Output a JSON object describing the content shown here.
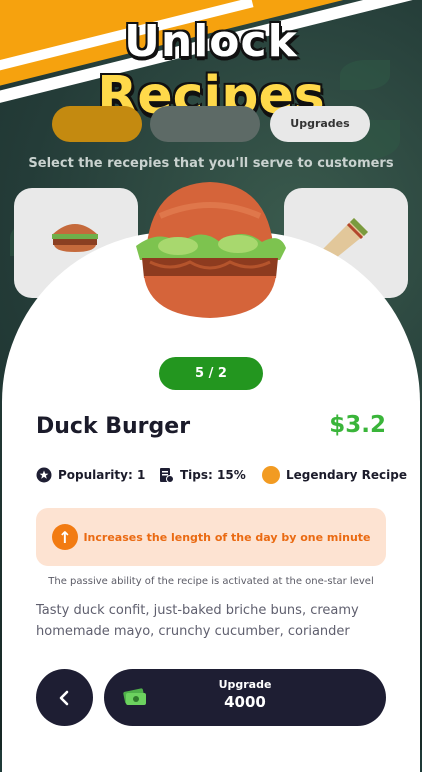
{
  "header": {
    "title_line1": "Unlock",
    "title_line2": "Recipes"
  },
  "tabs": [
    {
      "label": ""
    },
    {
      "label": ""
    },
    {
      "label": "Upgrades"
    }
  ],
  "subtitle": "Select the recepies that you'll serve to customers",
  "recipe": {
    "level": "5 / 2",
    "name": "Duck Burger",
    "price": "$3.2",
    "popularity": "Popularity: 1",
    "tips": "Tips: 15%",
    "rarity": "Legendary Recipe",
    "ability": "Increases the length of the day by one minute",
    "ability_note": "The passive ability of the recipe is activated at the one-star level",
    "description": "Tasty duck confit, just-baked briche buns, creamy homemade mayo, crunchy cucumber, coriander"
  },
  "actions": {
    "upgrade_label": "Upgrade",
    "upgrade_cost": "4000"
  },
  "colors": {
    "accent_green": "#3ab53a",
    "orange": "#f27b12",
    "dark": "#1e1e33",
    "banner": "#f6a20e"
  },
  "icons": [
    "back-arrow-icon",
    "money-icon",
    "popularity-star-icon",
    "tips-receipt-icon",
    "arrow-up-icon"
  ]
}
